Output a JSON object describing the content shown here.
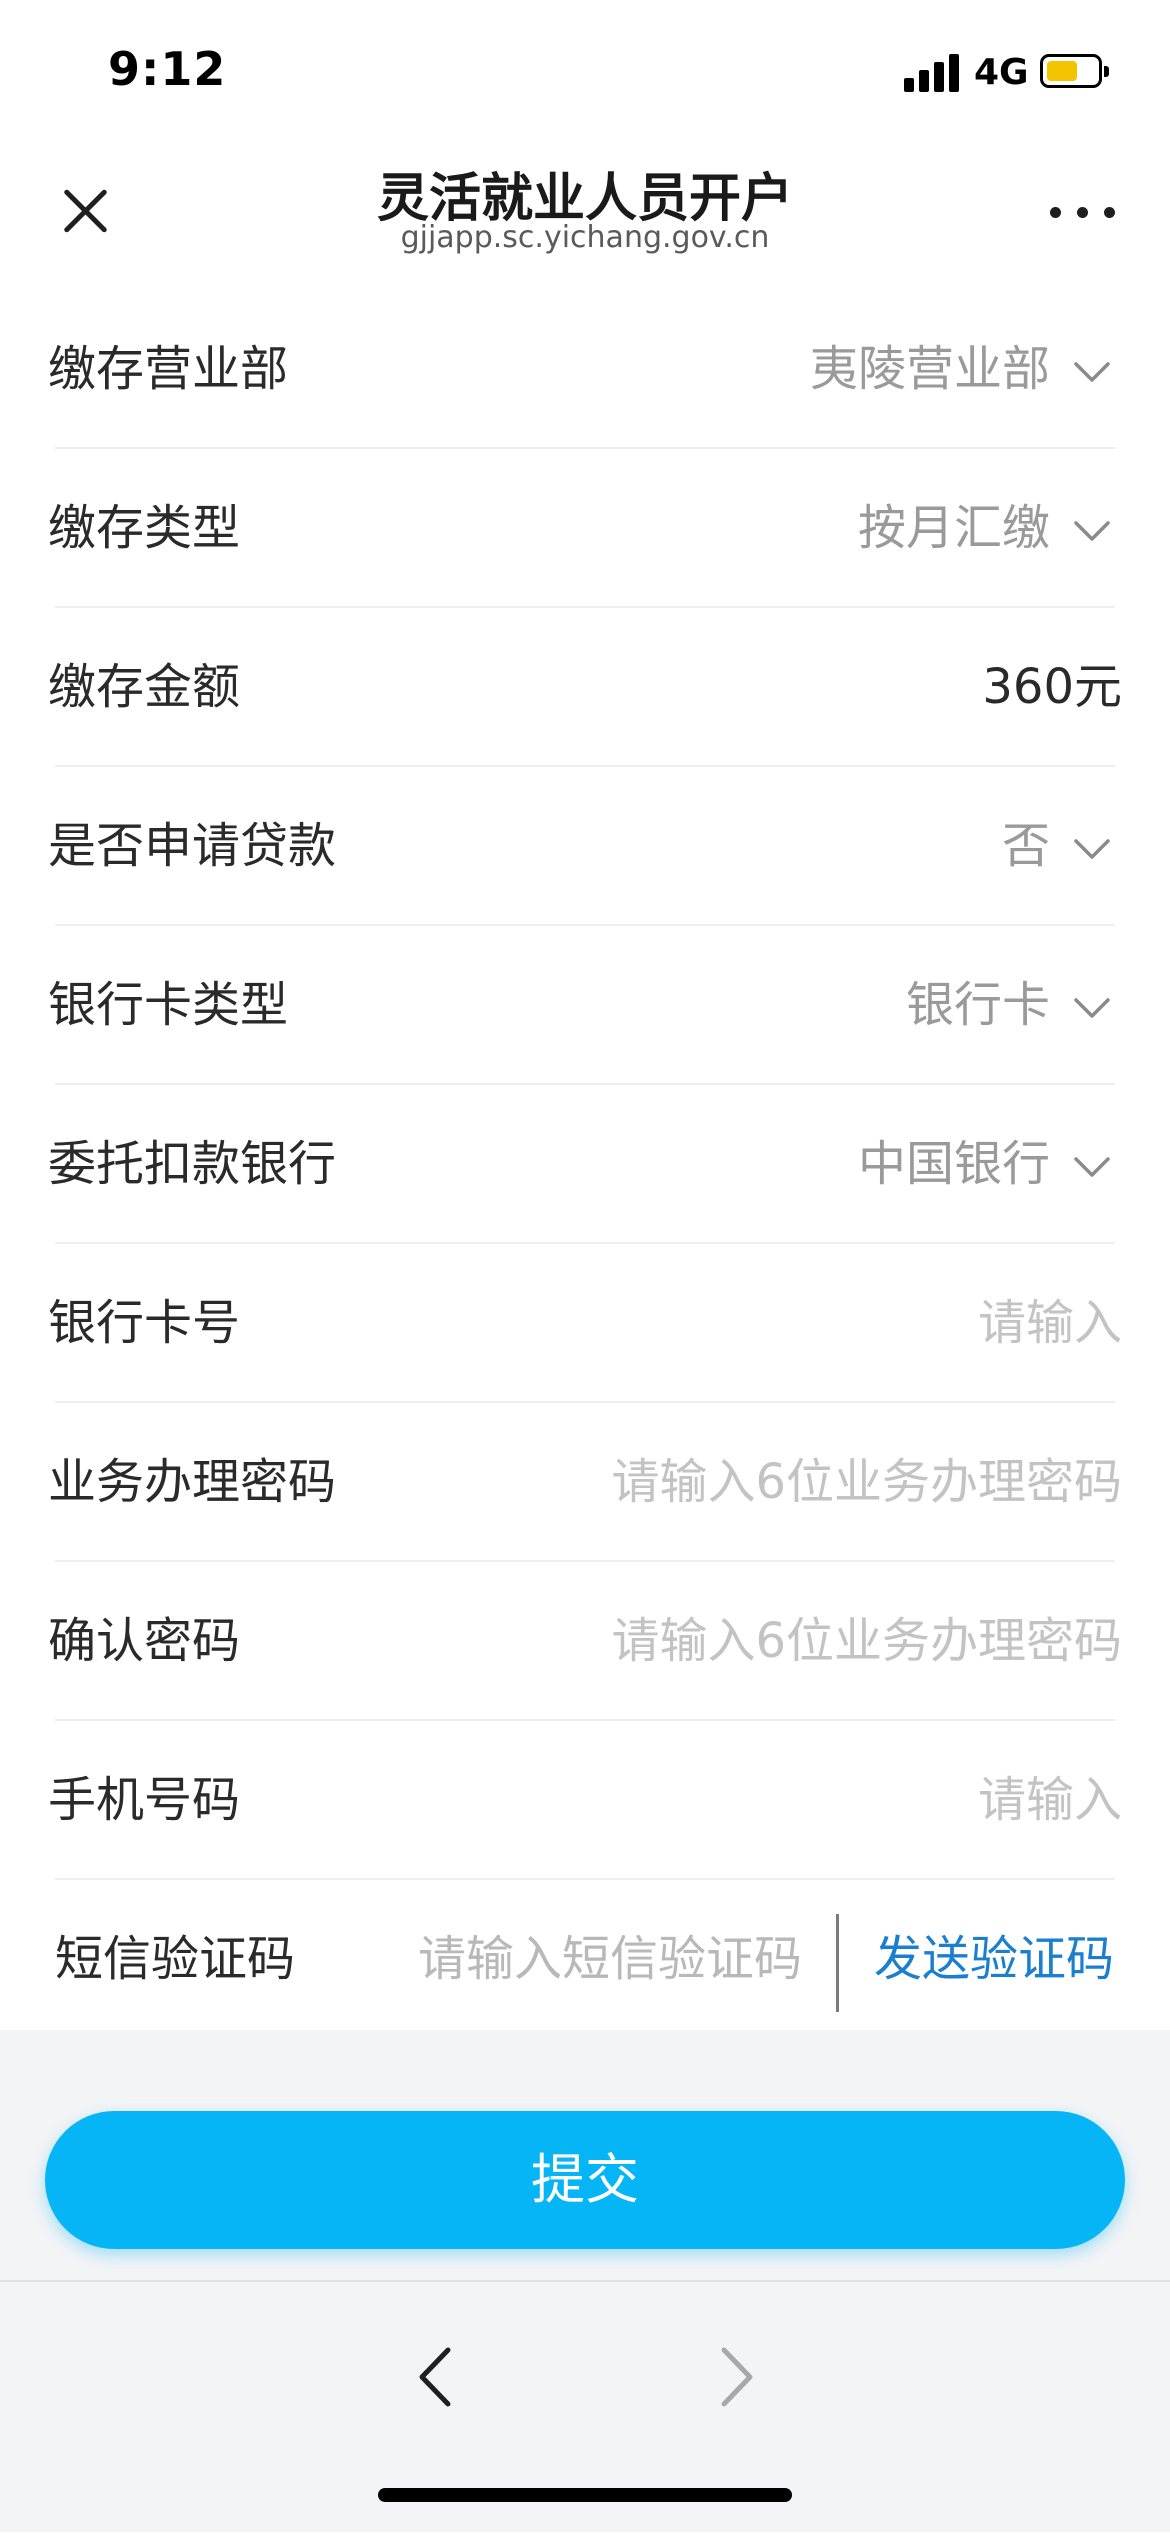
{
  "status_bar": {
    "time": "9:12",
    "network": "4G",
    "battery_level": 0.6,
    "battery_color": "#f5c400"
  },
  "nav": {
    "title": "灵活就业人员开户",
    "url": "gjjapp.sc.yichang.gov.cn",
    "close_icon": "close-icon",
    "more_icon": "more-dots-icon"
  },
  "form": {
    "rows": [
      {
        "label": "缴存营业部",
        "value": "夷陵营业部",
        "kind": "select"
      },
      {
        "label": "缴存类型",
        "value": "按月汇缴",
        "kind": "select"
      },
      {
        "label": "缴存金额",
        "value": "360元",
        "kind": "text"
      },
      {
        "label": "是否申请贷款",
        "value": "否",
        "kind": "select"
      },
      {
        "label": "银行卡类型",
        "value": "银行卡",
        "kind": "select"
      },
      {
        "label": "委托扣款银行",
        "value": "中国银行",
        "kind": "select"
      },
      {
        "label": "银行卡号",
        "placeholder": "请输入",
        "kind": "input"
      },
      {
        "label": "业务办理密码",
        "placeholder": "请输入6位业务办理密码",
        "kind": "input"
      },
      {
        "label": "确认密码",
        "placeholder": "请输入6位业务办理密码",
        "kind": "input"
      },
      {
        "label": "手机号码",
        "placeholder": "请输入",
        "kind": "input"
      }
    ],
    "sms": {
      "label": "短信验证码",
      "placeholder": "请输入短信验证码",
      "send_label": "发送验证码"
    }
  },
  "submit_label": "提交",
  "toolbar": {
    "back_icon": "chevron-left-icon",
    "forward_icon": "chevron-right-icon"
  },
  "colors": {
    "accent": "#06b5f5",
    "link": "#1b7fd0"
  }
}
